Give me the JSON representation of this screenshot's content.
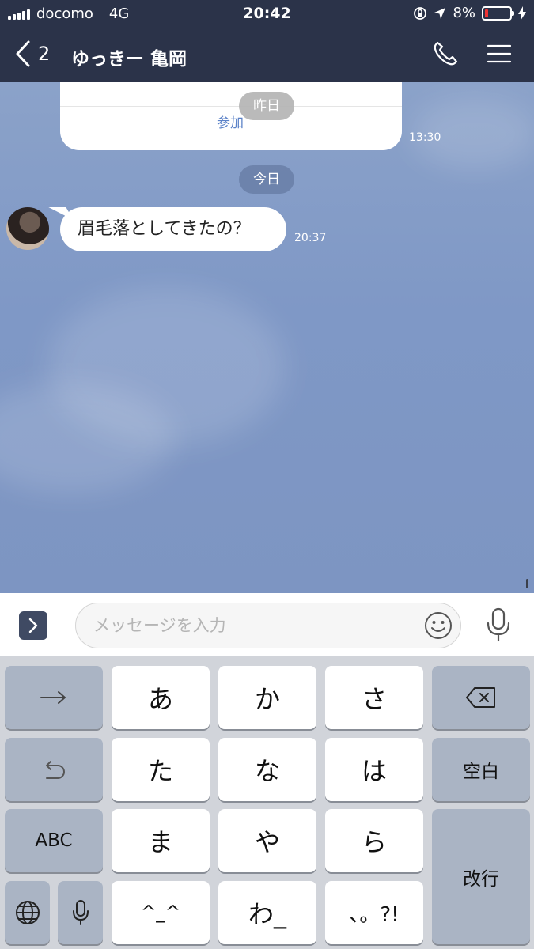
{
  "status_bar": {
    "carrier": "docomo",
    "network": "4G",
    "time": "20:42",
    "battery": "8%"
  },
  "header": {
    "back_count": "2",
    "title": "ゆっきー 亀岡"
  },
  "chat": {
    "card_join_label": "参加",
    "date_yesterday": "昨日",
    "card_time": "13:30",
    "date_today": "今日",
    "message": {
      "text": "眉毛落としてきたの？",
      "time": "20:37"
    }
  },
  "input": {
    "placeholder": "メッセージを入力"
  },
  "keyboard": {
    "rows": [
      [
        "→",
        "あ",
        "か",
        "さ",
        "⌫"
      ],
      [
        "↺",
        "た",
        "な",
        "は",
        "空白"
      ],
      [
        "ABC",
        "ま",
        "や",
        "ら",
        "改行"
      ],
      [
        "🌐",
        "🎤",
        "^_^",
        "わ_",
        "、。?!"
      ]
    ],
    "k_a": "あ",
    "k_ka": "か",
    "k_sa": "さ",
    "k_ta": "た",
    "k_na": "な",
    "k_ha": "は",
    "k_space": "空白",
    "k_abc": "ABC",
    "k_ma": "ま",
    "k_ya": "や",
    "k_ra": "ら",
    "k_return": "改行",
    "k_face": "^_^",
    "k_wa": "わ_",
    "k_punct": "、。?!"
  },
  "colors": {
    "header_bg": "#2b3349",
    "chat_bg": "#8098c5",
    "accent_link": "#5b82c8",
    "battery_low": "#e33333"
  }
}
